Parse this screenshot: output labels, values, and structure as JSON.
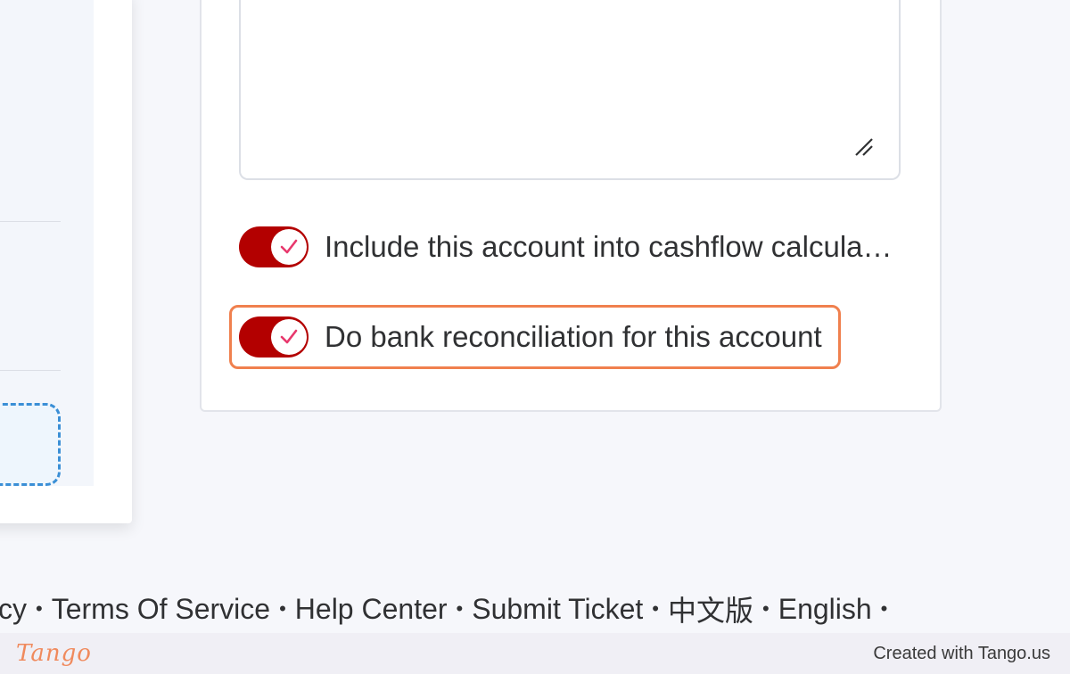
{
  "form": {
    "toggles": [
      {
        "label": "Include this account into cashflow calcula…",
        "checked": true
      },
      {
        "label": "Do bank reconciliation for this account",
        "checked": true
      }
    ]
  },
  "footer": {
    "links": [
      "cy",
      "Terms Of Service",
      "Help Center",
      "Submit Ticket",
      "中文版",
      "English"
    ],
    "separator": "•"
  },
  "tango": {
    "logo": "Tango",
    "credit": "Created with Tango.us"
  },
  "colors": {
    "switch_on": "#b30000",
    "check": "#e8386d",
    "highlight": "#f0804e",
    "upload_border": "#3a8fd6"
  }
}
